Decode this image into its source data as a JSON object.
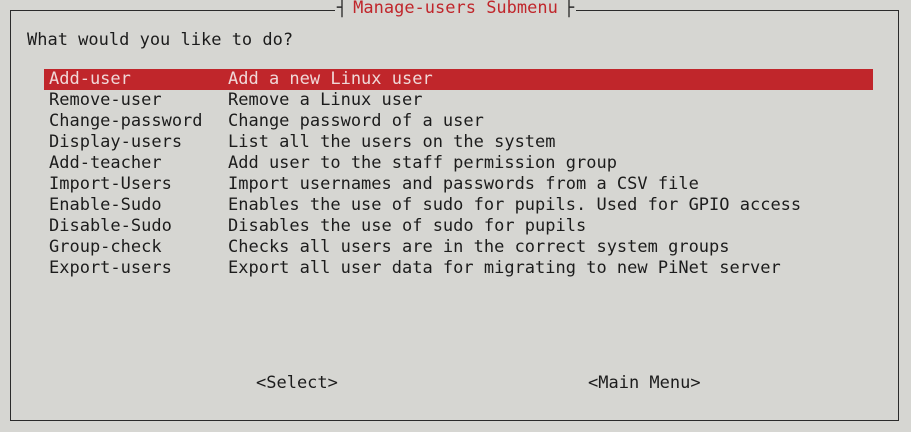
{
  "dialog": {
    "title": "Manage-users Submenu",
    "prompt": "What would you like to do?"
  },
  "menu": {
    "selected_index": 0,
    "items": [
      {
        "tag": "Add-user",
        "desc": "Add a new Linux user"
      },
      {
        "tag": "Remove-user",
        "desc": "Remove a Linux user"
      },
      {
        "tag": "Change-password",
        "desc": "Change password of a user"
      },
      {
        "tag": "Display-users",
        "desc": "List all the users on the system"
      },
      {
        "tag": "Add-teacher",
        "desc": "Add user to the staff permission group"
      },
      {
        "tag": "Import-Users",
        "desc": "Import usernames and passwords from a CSV file"
      },
      {
        "tag": "Enable-Sudo",
        "desc": "Enables the use of sudo for pupils. Used for GPIO access"
      },
      {
        "tag": "Disable-Sudo",
        "desc": "Disables the use of sudo for pupils"
      },
      {
        "tag": "Group-check",
        "desc": "Checks all users are in the correct system groups"
      },
      {
        "tag": "Export-users",
        "desc": "Export all user data for migrating to new PiNet server"
      }
    ]
  },
  "buttons": {
    "select": "<Select>",
    "main_menu": "<Main Menu>"
  },
  "colors": {
    "background": "#d6d6d2",
    "accent": "#c0262b",
    "text": "#1c1c1c"
  }
}
